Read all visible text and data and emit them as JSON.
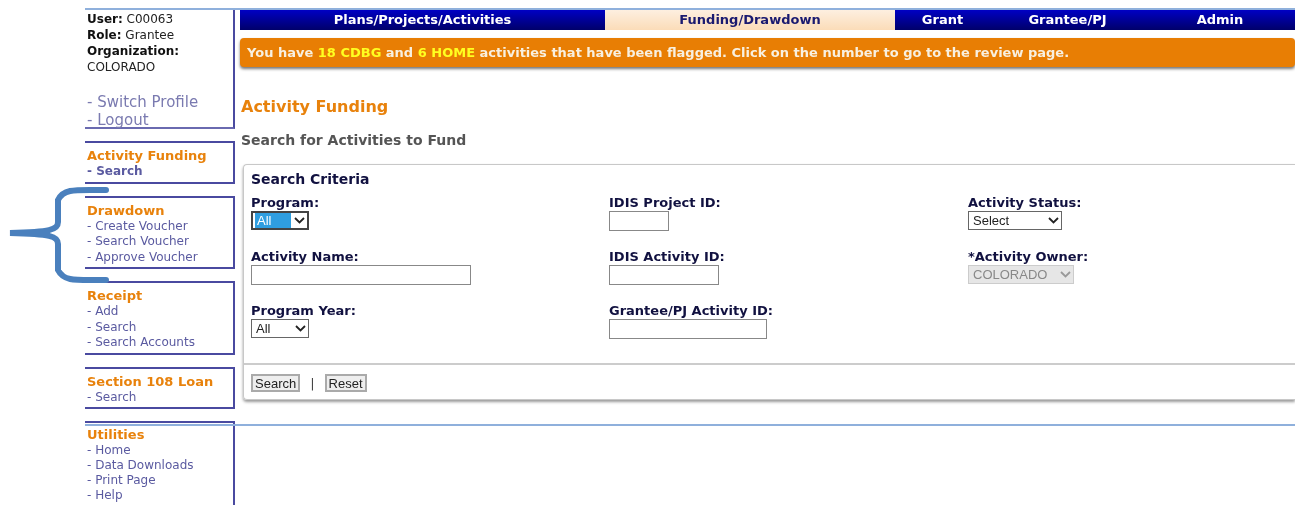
{
  "user_info": [
    {
      "label": "User:",
      "value": "C00063"
    },
    {
      "label": "Role:",
      "value": "Grantee"
    },
    {
      "label": "Organization:",
      "value": "COLORADO"
    }
  ],
  "profile_links": [
    "- Switch Profile",
    "- Logout"
  ],
  "sidebar": [
    {
      "title": "Activity Funding",
      "items": [
        "- Search"
      ]
    },
    {
      "title": "Drawdown",
      "items": [
        "- Create Voucher",
        "- Search Voucher",
        "- Approve Voucher"
      ]
    },
    {
      "title": "Receipt",
      "items": [
        "- Add",
        "- Search",
        "- Search Accounts"
      ]
    },
    {
      "title": "Section 108 Loan",
      "items": [
        "- Search"
      ]
    },
    {
      "title": "Utilities",
      "items": [
        "- Home",
        "- Data Downloads",
        "- Print Page",
        "- Help"
      ]
    }
  ],
  "tabs": [
    {
      "label": "Plans/Projects/Activities",
      "selected": false
    },
    {
      "label": "Funding/Drawdown",
      "selected": true
    },
    {
      "label": "Grant",
      "selected": false
    },
    {
      "label": "Grantee/PJ",
      "selected": false
    },
    {
      "label": "Admin",
      "selected": false
    }
  ],
  "alert": "You have **18 CDBG** and **6 HOME** activities that have been flagged. Click on the number to go to the review page.",
  "page_title": "Activity Funding",
  "subtitle": "Search for Activities to Fund",
  "search_panel": {
    "title": "Search Criteria",
    "columns": [
      [
        {
          "kind": "select",
          "label": "Program:",
          "value": "All",
          "highlighted": true,
          "disabled": false
        },
        {
          "kind": "text",
          "label": "Activity Name:"
        },
        {
          "kind": "select",
          "label": "Program Year:",
          "value": "All",
          "highlighted": false,
          "disabled": false
        }
      ],
      [
        {
          "kind": "text",
          "label": "IDIS Project ID:"
        },
        {
          "kind": "text",
          "label": "IDIS Activity ID:"
        },
        {
          "kind": "text",
          "label": "Grantee/PJ Activity ID:"
        }
      ],
      [
        {
          "kind": "select",
          "label": "Activity Status:",
          "value": "Select",
          "highlighted": false,
          "disabled": false
        },
        {
          "kind": "select",
          "label": "*Activity Owner:",
          "value": "COLORADO",
          "highlighted": false,
          "disabled": true
        }
      ]
    ],
    "buttons": [
      "Search",
      "Reset"
    ],
    "separator": "|"
  }
}
